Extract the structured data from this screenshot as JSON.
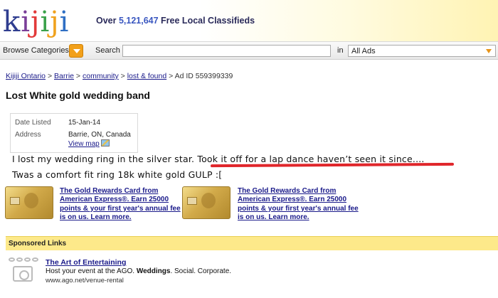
{
  "header": {
    "logo_letters": [
      {
        "ch": "k",
        "color": "#2f3d8f"
      },
      {
        "ch": "i",
        "color": "#7a3f98"
      },
      {
        "ch": "j",
        "color": "#e23a3a"
      },
      {
        "ch": "i",
        "color": "#3aa14a"
      },
      {
        "ch": "j",
        "color": "#f0a21e"
      },
      {
        "ch": "i",
        "color": "#2f6fc4"
      }
    ],
    "tagline_prefix": "Over ",
    "tagline_count": "5,121,647",
    "tagline_suffix": " Free Local Classifieds"
  },
  "searchbar": {
    "browse_label": "Browse Categories",
    "search_label": "Search",
    "search_value": "",
    "in_label": "in",
    "category_value": "All Ads"
  },
  "breadcrumb": {
    "items": [
      "Kijiji Ontario",
      "Barrie",
      "community",
      "lost & found"
    ],
    "separator": " > ",
    "ad_id": "Ad ID 559399339"
  },
  "listing": {
    "title": "Lost White gold wedding band",
    "details": {
      "date_label": "Date Listed",
      "date_value": "15-Jan-14",
      "address_label": "Address",
      "address_value": "Barrie, ON, Canada",
      "view_map": "View map"
    },
    "description_line1_a": "I lost my wedding ring in the silver star. ",
    "description_line1_b": "Took it off for a lap dance haven’t seen it since....",
    "description_line2": "Twas a comfort fit ring 18k white gold GULP :["
  },
  "ads": [
    {
      "text": "The Gold Rewards Card from American Express®. Earn 25000 points & your first year's annual fee is on us. Learn more."
    },
    {
      "text": "The Gold Rewards Card from American Express®. Earn 25000 points & your first year's annual fee is on us. Learn more."
    }
  ],
  "sponsored": {
    "heading": "Sponsored Links",
    "title": "The Art of Entertaining",
    "desc_prefix": "Host your event at the AGO. ",
    "desc_bold": "Weddings",
    "desc_suffix": ". Social. Corporate.",
    "url": "www.ago.net/venue-rental"
  },
  "colors": {
    "accent_orange": "#f2a01a",
    "link_blue": "#1a1a8a",
    "annotation_red": "#e0262b",
    "sponsored_yellow": "#fde98a"
  }
}
